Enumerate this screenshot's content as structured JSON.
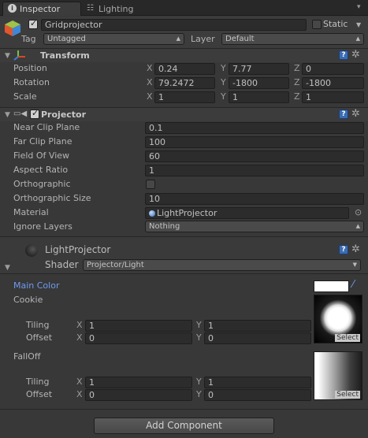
{
  "tabs": [
    {
      "label": "Inspector",
      "icon": "info-icon",
      "active": true
    },
    {
      "label": "Lighting",
      "icon": "lighting-icon",
      "active": false
    }
  ],
  "object": {
    "name": "Gridprojector",
    "static_label": "Static",
    "tag_label": "Tag",
    "tag_value": "Untagged",
    "layer_label": "Layer",
    "layer_value": "Default"
  },
  "transform": {
    "title": "Transform",
    "rows": [
      {
        "label": "Position",
        "x": "0.24",
        "y": "7.77",
        "z": "0"
      },
      {
        "label": "Rotation",
        "x": "79.2472",
        "y": "-1800",
        "z": "-1800"
      },
      {
        "label": "Scale",
        "x": "1",
        "y": "1",
        "z": "1"
      }
    ]
  },
  "axes": {
    "x": "X",
    "y": "Y",
    "z": "Z"
  },
  "projector": {
    "title": "Projector",
    "rows": [
      {
        "label": "Near Clip Plane",
        "value": "0.1"
      },
      {
        "label": "Far Clip Plane",
        "value": "100"
      },
      {
        "label": "Field Of View",
        "value": "60"
      },
      {
        "label": "Aspect Ratio",
        "value": "1"
      }
    ],
    "ortho_label": "Orthographic",
    "ortho_size_label": "Orthographic Size",
    "ortho_size_value": "10",
    "material_label": "Material",
    "material_value": "LightProjector",
    "ignore_label": "Ignore Layers",
    "ignore_value": "Nothing"
  },
  "material": {
    "name": "LightProjector",
    "shader_label": "Shader",
    "shader_value": "Projector/Light",
    "main_color_label": "Main Color",
    "main_color": "#ffffff",
    "cookie_label": "Cookie",
    "falloff_label": "FallOff",
    "tiling_label": "Tiling",
    "offset_label": "Offset",
    "cookie_tiling": {
      "x": "1",
      "y": "1"
    },
    "cookie_offset": {
      "x": "0",
      "y": "0"
    },
    "falloff_tiling": {
      "x": "1",
      "y": "1"
    },
    "falloff_offset": {
      "x": "0",
      "y": "0"
    },
    "select_label": "Select"
  },
  "add_component_label": "Add Component",
  "colors": {
    "accent_label": "#6e9bf0",
    "help_icon": "#3a6cb4",
    "panel": "#383838"
  }
}
